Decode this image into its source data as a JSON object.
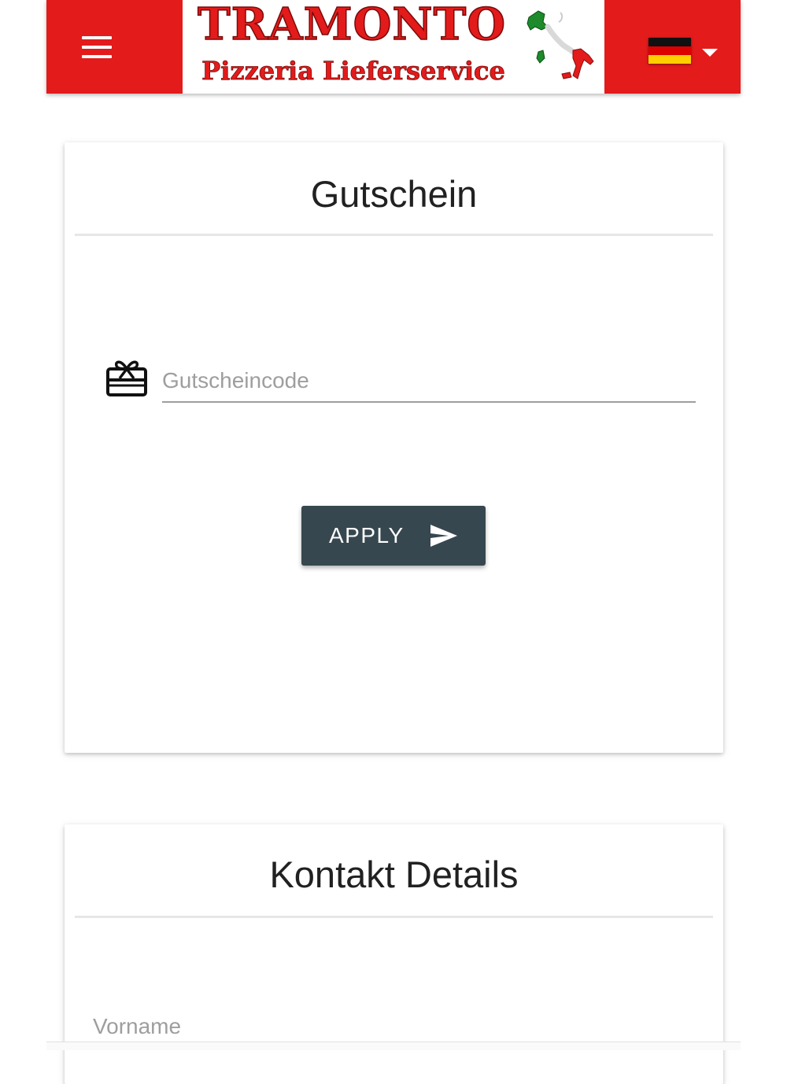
{
  "header": {
    "brand_color": "#e31b1b",
    "menu_icon": "hamburger-menu-icon",
    "logo": {
      "title": "TRAMONTO",
      "subtitle": "Pizzeria Lieferservice",
      "map_icon": "italy-map-icon"
    },
    "language": {
      "flag_icon": "german-flag-icon",
      "dropdown_icon": "caret-down-icon"
    }
  },
  "voucher": {
    "title": "Gutschein",
    "input_icon": "gift-card-icon",
    "input_placeholder": "Gutscheincode",
    "input_value": "",
    "apply_label": "APPLY",
    "apply_icon": "send-icon",
    "button_color": "#37474f"
  },
  "contact": {
    "title": "Kontakt Details",
    "first_name_label": "Vorname"
  }
}
